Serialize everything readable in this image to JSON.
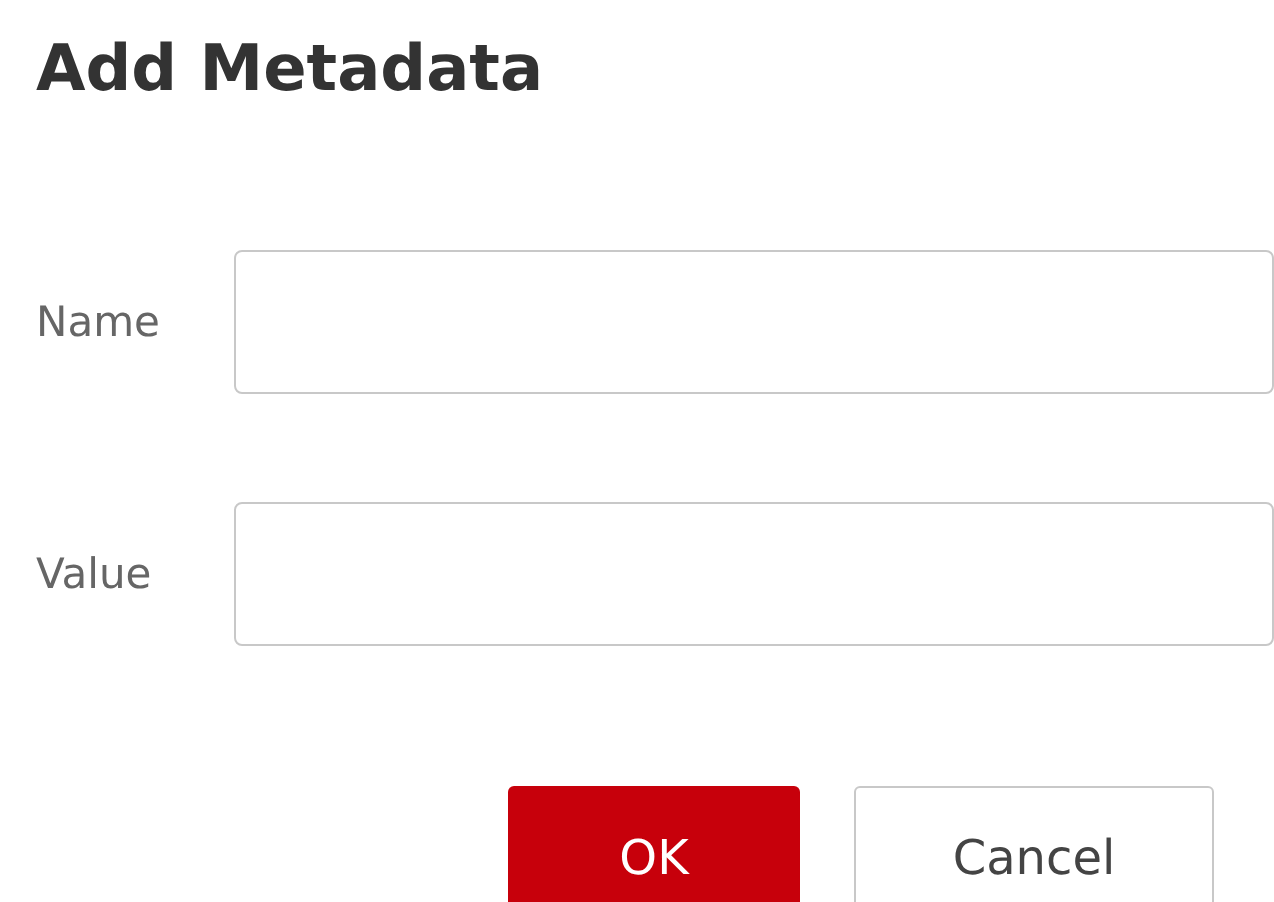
{
  "dialog": {
    "title": "Add Metadata"
  },
  "fields": [
    {
      "label": "Name"
    },
    {
      "label": "Value"
    }
  ],
  "buttons": [
    {
      "label": "OK",
      "kind": "primary"
    },
    {
      "label": "Cancel",
      "kind": "secondary"
    }
  ]
}
